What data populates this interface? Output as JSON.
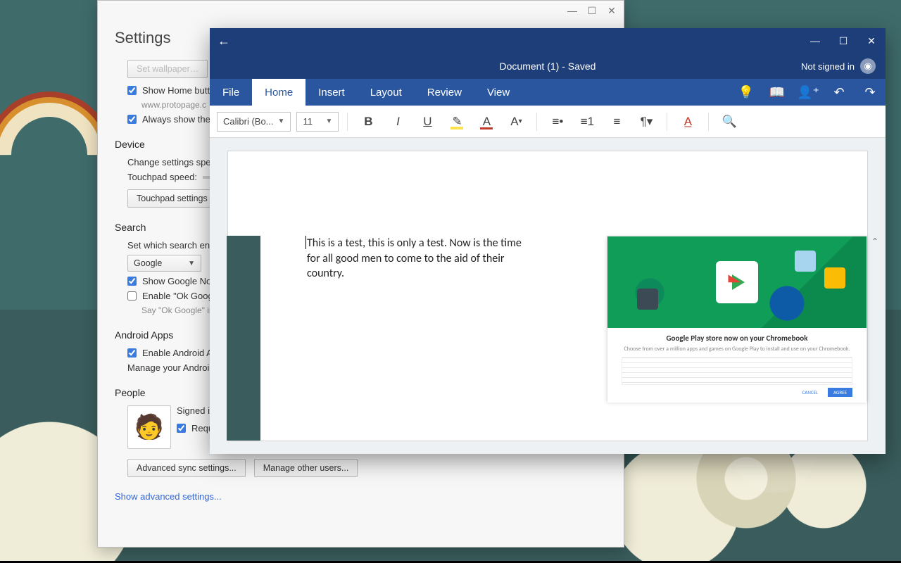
{
  "settings": {
    "title": "Settings",
    "home_button_label": "Show Home button",
    "home_button_sub": "www.protopage.c",
    "always_show_label": "Always show the b",
    "device_header": "Device",
    "device_desc": "Change settings specif",
    "touchpad_speed": "Touchpad speed:",
    "touchpad_settings_btn": "Touchpad settings",
    "search_header": "Search",
    "search_desc": "Set which search engin",
    "search_engine": "Google",
    "show_google_now": "Show Google Now",
    "enable_ok_google": "Enable \"Ok Google",
    "ok_google_hint": "Say \"Ok Google\" in",
    "android_header": "Android Apps",
    "enable_android": "Enable Android Ap",
    "manage_android": "Manage your Android",
    "people_header": "People",
    "signed_in": "Signed in",
    "require_password": "Require password to wake from sleep",
    "adv_sync": "Advanced sync settings...",
    "manage_users": "Manage other users...",
    "show_advanced": "Show advanced settings..."
  },
  "word": {
    "doc_title": "Document (1)  -  Saved",
    "not_signed_in": "Not signed in",
    "tabs": {
      "file": "File",
      "home": "Home",
      "insert": "Insert",
      "layout": "Layout",
      "review": "Review",
      "view": "View"
    },
    "font_name": "Calibri (Bo...",
    "font_size": "11",
    "body_text": "This is a test, this is only a test. Now is the time for all good men to come to the aid of their country.",
    "play_heading": "Google Play store now on your Chromebook",
    "play_sub": "Choose from over a million apps and games on Google Play to install and use on your Chromebook.",
    "btn_cancel": "CANCEL",
    "btn_agree": "AGREE"
  }
}
